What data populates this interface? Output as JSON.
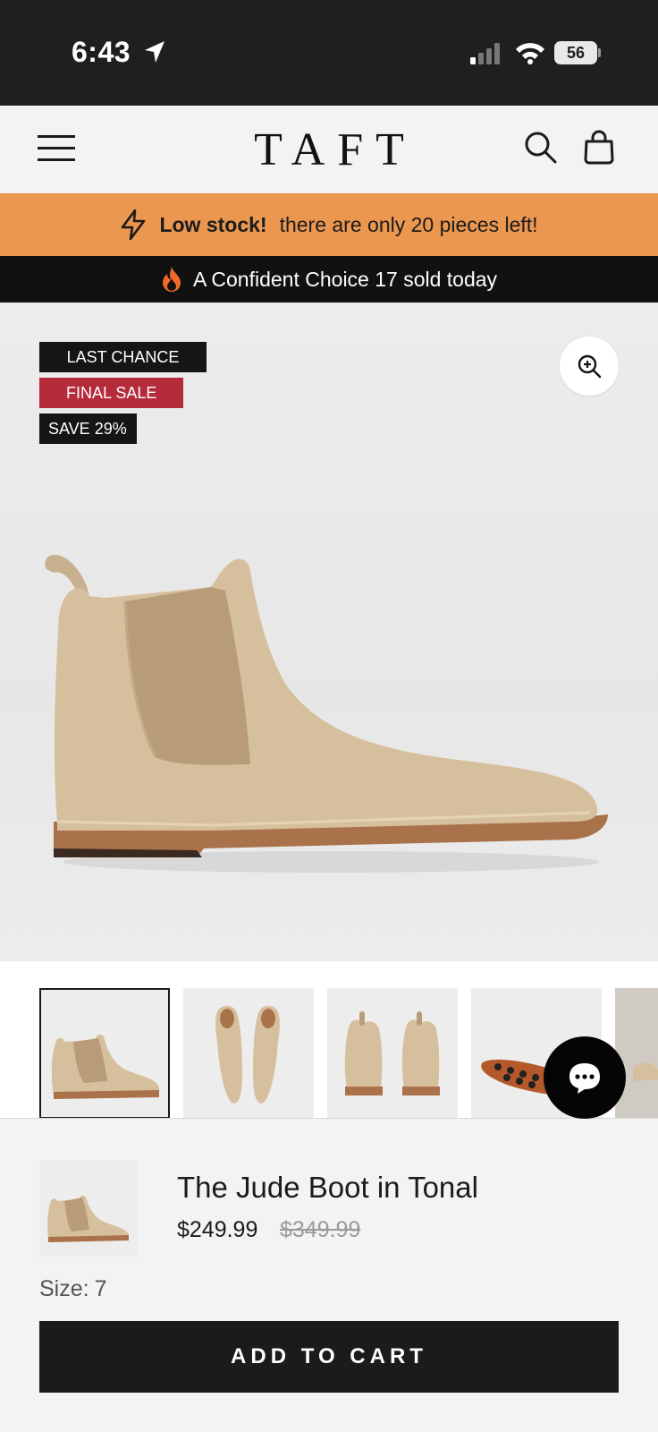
{
  "status_bar": {
    "time": "6:43",
    "battery": "56"
  },
  "header": {
    "logo": "TAFT"
  },
  "banners": {
    "low_stock_bold": "Low stock!",
    "low_stock_text": "there are only 20 pieces left!",
    "sold_text": "A Confident Choice 17 sold today"
  },
  "badges": {
    "last_chance": "LAST CHANCE",
    "final_sale": "FINAL SALE",
    "save": "SAVE 29%"
  },
  "product": {
    "title": "The Jude Boot in Tonal",
    "price": "$249.99",
    "compare_price": "$349.99",
    "size_label": "Size:",
    "size_value": "7"
  },
  "cart": {
    "add_label": "ADD TO CART"
  },
  "colors": {
    "accent_orange": "#ec974f",
    "sale_red": "#b52b3b",
    "suede": "#d6bf9c",
    "dark": "#1b1b1b"
  },
  "thumbnails": [
    {
      "name": "side-view"
    },
    {
      "name": "top-view"
    },
    {
      "name": "back-view"
    },
    {
      "name": "sole-view"
    },
    {
      "name": "lifestyle-view"
    }
  ]
}
